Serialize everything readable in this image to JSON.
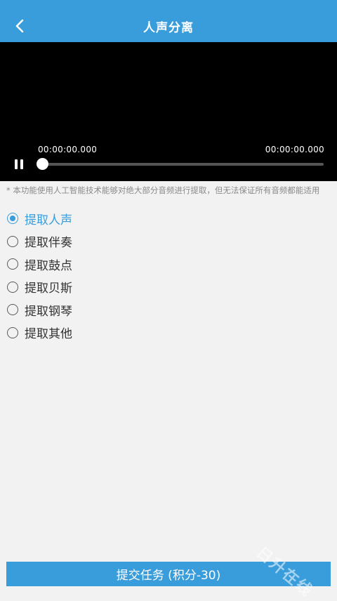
{
  "header": {
    "title": "人声分离",
    "back_icon": "chevron-left-icon",
    "color": "#3a9ddb"
  },
  "player": {
    "current_time": "00:00:00.000",
    "total_time": "00:00:00.000",
    "state_icon": "pause-icon",
    "progress": 0
  },
  "notice": "* 本功能使用人工智能技术能够对绝大部分音频进行提取，但无法保证所有音频都能适用",
  "options": [
    {
      "label": "提取人声",
      "selected": true
    },
    {
      "label": "提取伴奏",
      "selected": false
    },
    {
      "label": "提取鼓点",
      "selected": false
    },
    {
      "label": "提取贝斯",
      "selected": false
    },
    {
      "label": "提取钢琴",
      "selected": false
    },
    {
      "label": "提取其他",
      "selected": false
    }
  ],
  "submit_label": "提交任务 (积分-30)",
  "watermark": "日升在线"
}
